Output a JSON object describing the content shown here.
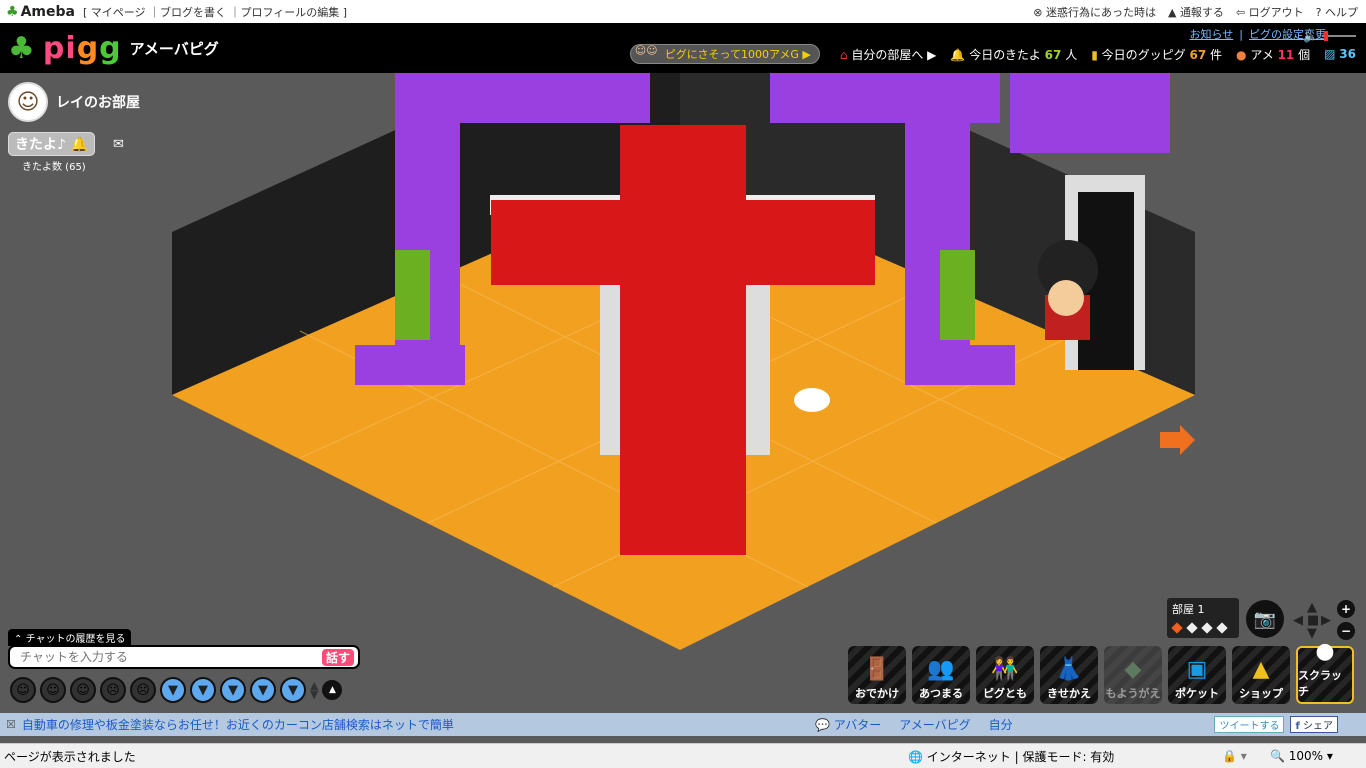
{
  "ameba": {
    "logo": "Ameba",
    "links": "[ マイページ ｜ブログを書く ｜プロフィールの編集 ]",
    "report_help": "迷惑行為にあった時は",
    "report": "通報する",
    "logout": "ログアウト",
    "help": "ヘルプ"
  },
  "pigg": {
    "logo": "pigg",
    "subtitle": "アメーバピグ",
    "notice": "お知らせ",
    "settings": "ピグの設定変更",
    "campaign": "ピグにさそって1000アメG",
    "my_room": "自分の部屋へ",
    "kitayo_label": "今日のきたよ",
    "kitayo_count": "67",
    "kitayo_unit": "人",
    "guppy_label": "今日のグッピグ",
    "guppy_count": "67",
    "guppy_unit": "件",
    "ame_label": "アメ",
    "ame_count": "11",
    "ame_unit": "個",
    "coin_count": "36"
  },
  "room": {
    "owner": "レイのお部屋",
    "kitayo_button": "きたよ♪",
    "kitayo_total": "きたよ数 (65)",
    "room_label": "部屋",
    "room_number": "1"
  },
  "chat": {
    "history": "チャットの履歴を見る",
    "placeholder": "チャットを入力する",
    "talk": "話す"
  },
  "menu": [
    {
      "label": "おでかけ",
      "icon": "door-icon"
    },
    {
      "label": "あつまる",
      "icon": "group-icon"
    },
    {
      "label": "ピグとも",
      "icon": "friends-icon"
    },
    {
      "label": "きせかえ",
      "icon": "clothes-icon"
    },
    {
      "label": "もようがえ",
      "icon": "room-layout-icon"
    },
    {
      "label": "ポケット",
      "icon": "pocket-icon"
    },
    {
      "label": "ショップ",
      "icon": "shop-icon"
    },
    {
      "label": "スクラッチ",
      "icon": "scratch-icon"
    }
  ],
  "ad": {
    "text": "自動車の修理や板金塗装ならお任せ！お近くのカーコン店舗検索はネットで簡単",
    "link1": "アバター",
    "link2": "アメーバピグ",
    "link3": "自分",
    "tweet": "ツイートする",
    "share": "シェア"
  },
  "status": {
    "message": "ページが表示されました",
    "zone": "インターネット | 保護モード: 有効",
    "zoom": "100%"
  }
}
